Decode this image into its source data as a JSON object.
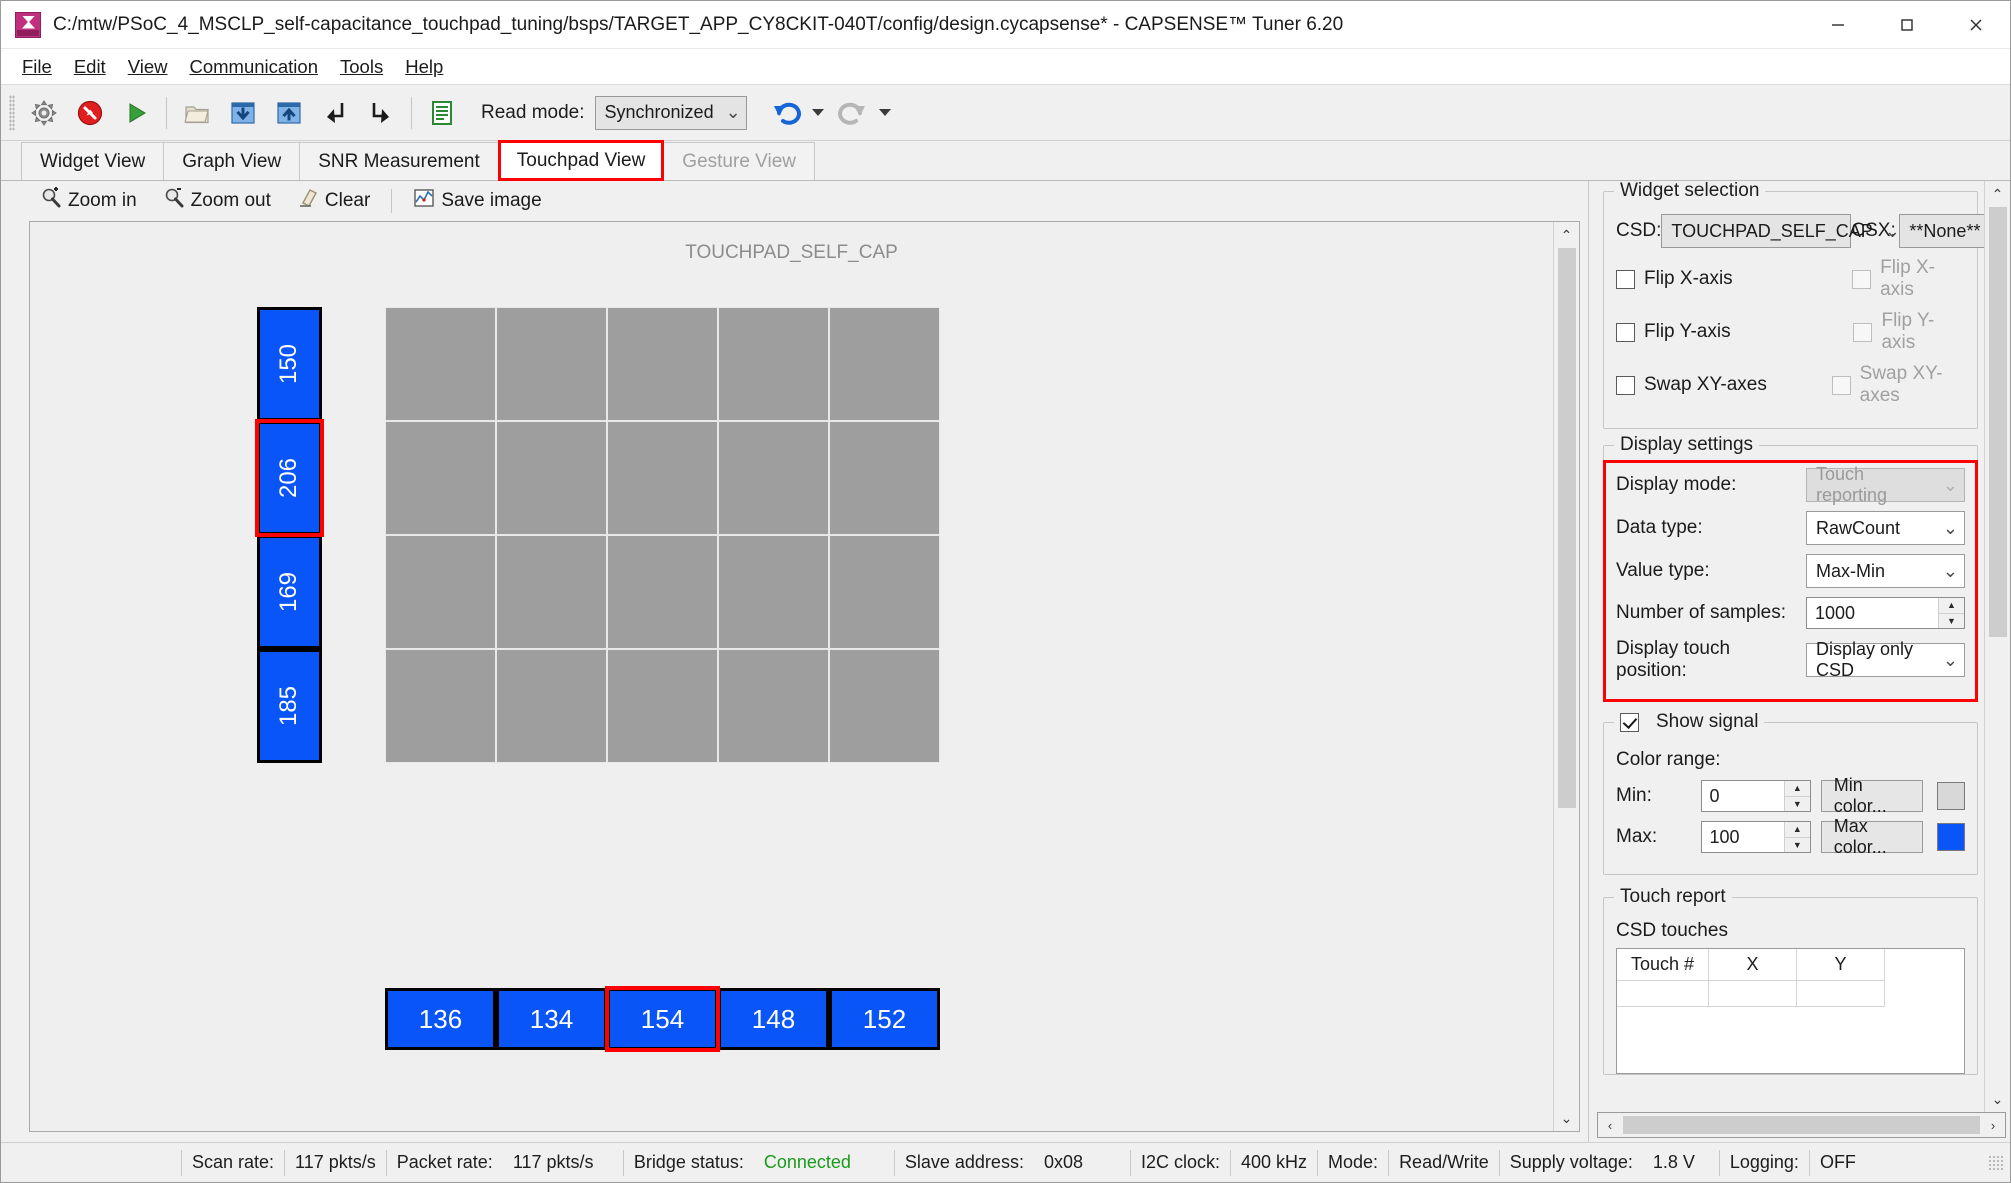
{
  "window": {
    "title": "C:/mtw/PSoC_4_MSCLP_self-capacitance_touchpad_tuning/bsps/TARGET_APP_CY8CKIT-040T/config/design.cycapsense* - CAPSENSE™ Tuner 6.20",
    "minimize": "–",
    "maximize": "□",
    "close": "✕"
  },
  "menu": [
    {
      "label": "File"
    },
    {
      "label": "Edit"
    },
    {
      "label": "View"
    },
    {
      "label": "Communication"
    },
    {
      "label": "Tools"
    },
    {
      "label": "Help"
    }
  ],
  "toolbar": {
    "buttons": [
      {
        "name": "configure-widgets-icon",
        "title": "Configure widgets"
      },
      {
        "name": "stop-icon",
        "title": "Stop"
      },
      {
        "name": "start-icon",
        "title": "Start"
      },
      {
        "name": "open-file-icon",
        "title": "Open configuration"
      },
      {
        "name": "apply-to-device-icon",
        "title": "Apply to device"
      },
      {
        "name": "read-from-device-icon",
        "title": "Read from device"
      },
      {
        "name": "import-icon",
        "title": "Import"
      },
      {
        "name": "export-icon",
        "title": "Export"
      },
      {
        "name": "log-icon",
        "title": "Logging"
      }
    ],
    "read_mode_label": "Read mode:",
    "read_mode_value": "Synchronized",
    "undo_title": "Undo",
    "redo_title": "Redo"
  },
  "tabs": [
    {
      "label": "Widget View",
      "active": false,
      "disabled": false
    },
    {
      "label": "Graph View",
      "active": false,
      "disabled": false
    },
    {
      "label": "SNR Measurement",
      "active": false,
      "disabled": false
    },
    {
      "label": "Touchpad View",
      "active": true,
      "disabled": false
    },
    {
      "label": "Gesture View",
      "active": false,
      "disabled": true
    }
  ],
  "view_toolbar": [
    {
      "label": "Zoom in",
      "icon": "zoom-in-icon"
    },
    {
      "label": "Zoom out",
      "icon": "zoom-out-icon"
    },
    {
      "label": "Clear",
      "icon": "clear-icon"
    },
    {
      "label": "Save image",
      "icon": "save-image-icon"
    }
  ],
  "touchpad": {
    "title": "TOUCHPAD_SELF_CAP",
    "y_sensors": [
      {
        "value": "150",
        "selected": false
      },
      {
        "value": "206",
        "selected": true
      },
      {
        "value": "169",
        "selected": false
      },
      {
        "value": "185",
        "selected": false
      }
    ],
    "x_sensors": [
      {
        "value": "136",
        "selected": false
      },
      {
        "value": "134",
        "selected": false
      },
      {
        "value": "154",
        "selected": true
      },
      {
        "value": "148",
        "selected": false
      },
      {
        "value": "152",
        "selected": false
      }
    ],
    "grid_columns": 5,
    "grid_rows": 4,
    "cell_color": "#9e9e9e",
    "sensor_color": "#0a55f7",
    "highlight_color": "#ff0000"
  },
  "widget_selection": {
    "legend": "Widget selection",
    "csd_label": "CSD:",
    "csd_value": "TOUCHPAD_SELF_CAP",
    "csx_label": "CSX:",
    "csx_value": "**None**",
    "csd_options": [
      {
        "label": "Flip X-axis",
        "checked": false
      },
      {
        "label": "Flip Y-axis",
        "checked": false
      },
      {
        "label": "Swap XY-axes",
        "checked": false
      }
    ],
    "csx_options": [
      {
        "label": "Flip X-axis",
        "checked": false,
        "disabled": true
      },
      {
        "label": "Flip Y-axis",
        "checked": false,
        "disabled": true
      },
      {
        "label": "Swap XY-axes",
        "checked": false,
        "disabled": true
      }
    ]
  },
  "display_settings": {
    "legend": "Display settings",
    "display_mode_label": "Display mode:",
    "display_mode_value": "Touch reporting",
    "data_type_label": "Data type:",
    "data_type_value": "RawCount",
    "value_type_label": "Value type:",
    "value_type_value": "Max-Min",
    "samples_label": "Number of samples:",
    "samples_value": "1000",
    "touch_position_label": "Display touch position:",
    "touch_position_value": "Display only CSD"
  },
  "show_signal": {
    "legend": "Show signal",
    "checked": true,
    "color_range_label": "Color range:",
    "min_label": "Min:",
    "min_value": "0",
    "min_color_button": "Min color...",
    "min_color": "#d8d8d8",
    "max_label": "Max:",
    "max_value": "100",
    "max_color_button": "Max color...",
    "max_color": "#0a55f7"
  },
  "touch_report": {
    "legend": "Touch report",
    "csd_label": "CSD touches",
    "columns": [
      "Touch #",
      "X",
      "Y"
    ],
    "rows": []
  },
  "statusbar": {
    "scan_rate_label": "Scan rate:",
    "scan_rate_value": "117 pkts/s",
    "packet_rate_label": "Packet rate:",
    "packet_rate_value": "117 pkts/s",
    "bridge_status_label": "Bridge status:",
    "bridge_status_value": "Connected",
    "slave_address_label": "Slave address:",
    "slave_address_value": "0x08",
    "i2c_clock_label": "I2C clock:",
    "i2c_clock_value": "400 kHz",
    "mode_label": "Mode:",
    "mode_value": "Read/Write",
    "supply_voltage_label": "Supply voltage:",
    "supply_voltage_value": "1.8 V",
    "logging_label": "Logging:",
    "logging_value": "OFF"
  }
}
